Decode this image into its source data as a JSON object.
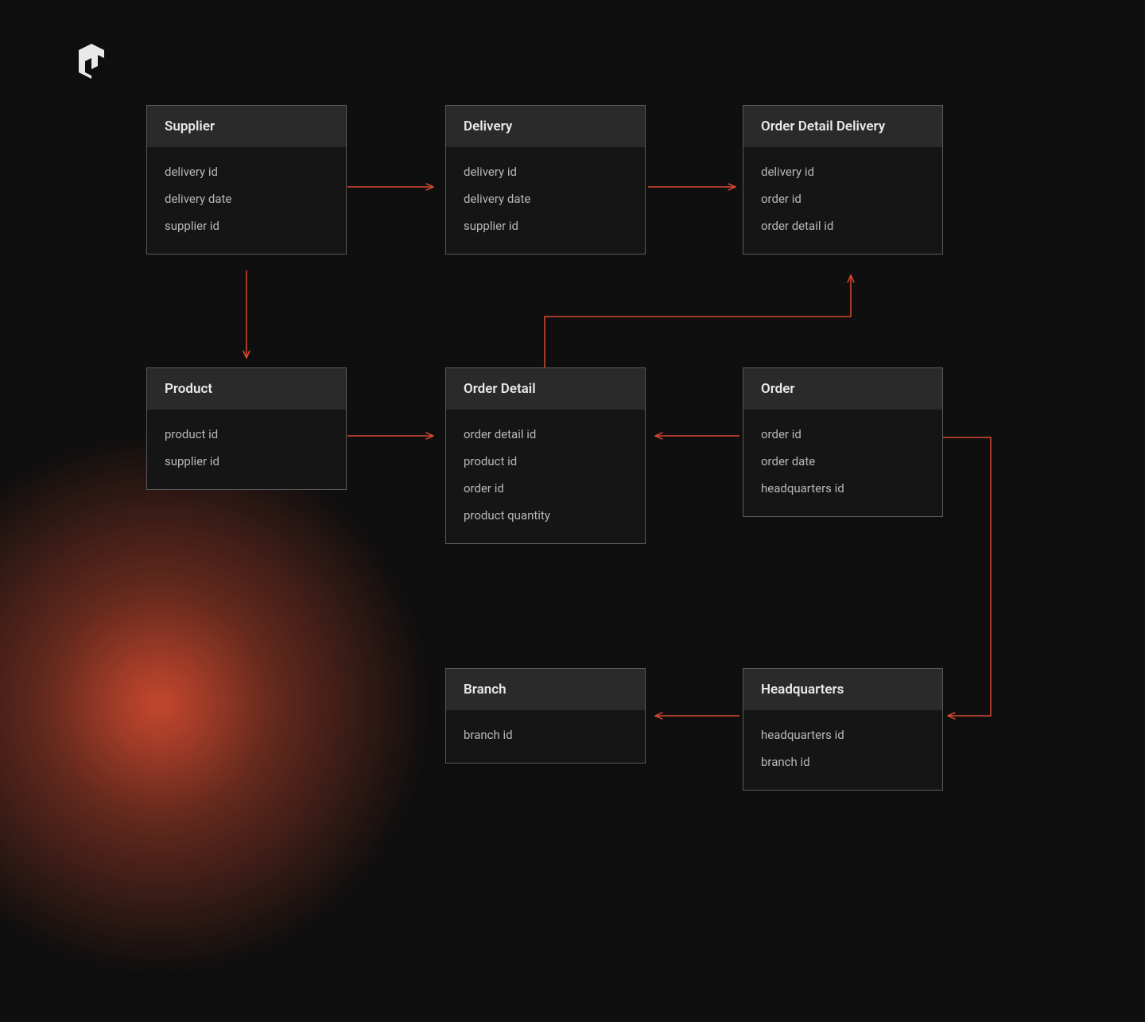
{
  "accent": "#d64933",
  "entities": {
    "supplier": {
      "title": "Supplier",
      "fields": [
        "delivery id",
        "delivery date",
        "supplier id"
      ]
    },
    "delivery": {
      "title": "Delivery",
      "fields": [
        "delivery id",
        "delivery date",
        "supplier id"
      ]
    },
    "order_detail_delivery": {
      "title": "Order Detail Delivery",
      "fields": [
        "delivery id",
        "order id",
        "order detail id"
      ]
    },
    "product": {
      "title": "Product",
      "fields": [
        "product id",
        "supplier id"
      ]
    },
    "order_detail": {
      "title": "Order Detail",
      "fields": [
        "order detail id",
        "product id",
        "order id",
        "product quantity"
      ]
    },
    "order": {
      "title": "Order",
      "fields": [
        "order id",
        "order date",
        "headquarters id"
      ]
    },
    "branch": {
      "title": "Branch",
      "fields": [
        "branch id"
      ]
    },
    "headquarters": {
      "title": "Headquarters",
      "fields": [
        "headquarters id",
        "branch id"
      ]
    }
  }
}
